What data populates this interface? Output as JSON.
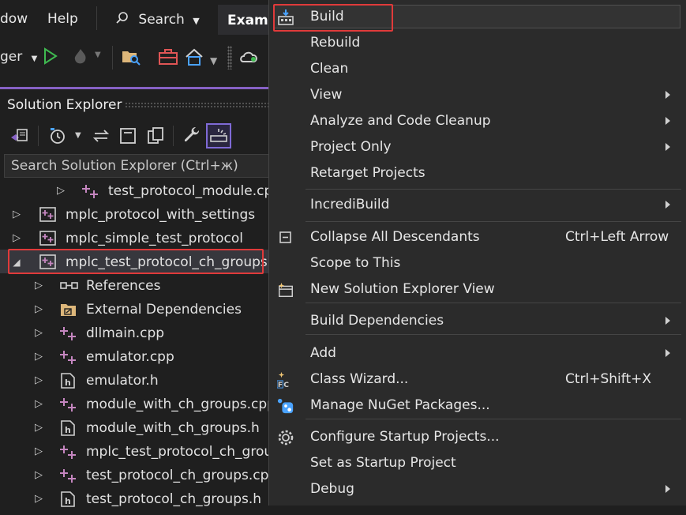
{
  "menubar": {
    "items": [
      "dow",
      "Help"
    ],
    "search_label": "Search",
    "document_tab": "Examp"
  },
  "toolbar": {
    "debugger_label": "ger"
  },
  "solution_explorer": {
    "title": "Solution Explorer",
    "search_placeholder": "Search Solution Explorer (Ctrl+ж)",
    "rows": [
      {
        "label": "test_protocol_module.cpp",
        "icon": "cpp-file-icon",
        "indent": 1,
        "expandable": true
      },
      {
        "label": "mplc_protocol_with_settings",
        "icon": "cpp-project-icon",
        "indent": 0,
        "expandable": true
      },
      {
        "label": "mplc_simple_test_protocol",
        "icon": "cpp-project-icon",
        "indent": 0,
        "expandable": true
      },
      {
        "label": "mplc_test_protocol_ch_groups",
        "icon": "cpp-project-icon",
        "indent": 0,
        "expandable": true,
        "expanded": true,
        "selected": true
      },
      {
        "label": "References",
        "icon": "references-icon",
        "indent": 1,
        "expandable": true
      },
      {
        "label": "External Dependencies",
        "icon": "folder-icon",
        "indent": 1,
        "expandable": true
      },
      {
        "label": "dllmain.cpp",
        "icon": "cpp-file-icon",
        "indent": 1,
        "expandable": true
      },
      {
        "label": "emulator.cpp",
        "icon": "cpp-file-icon",
        "indent": 1,
        "expandable": true
      },
      {
        "label": "emulator.h",
        "icon": "header-file-icon",
        "indent": 1,
        "expandable": true
      },
      {
        "label": "module_with_ch_groups.cpp",
        "icon": "cpp-file-icon",
        "indent": 1,
        "expandable": true
      },
      {
        "label": "module_with_ch_groups.h",
        "icon": "header-file-icon",
        "indent": 1,
        "expandable": true
      },
      {
        "label": "mplc_test_protocol_ch_group",
        "icon": "cpp-file-icon",
        "indent": 1,
        "expandable": true
      },
      {
        "label": "test_protocol_ch_groups.cpp",
        "icon": "cpp-file-icon",
        "indent": 1,
        "expandable": true
      },
      {
        "label": "test_protocol_ch_groups.h",
        "icon": "header-file-icon",
        "indent": 1,
        "expandable": true
      }
    ]
  },
  "context_menu": {
    "items": [
      {
        "label": "Build",
        "icon": "build-icon",
        "shortcut": "",
        "submenu": false,
        "highlighted": true
      },
      {
        "label": "Rebuild",
        "icon": "",
        "shortcut": "",
        "submenu": false
      },
      {
        "label": "Clean",
        "icon": "",
        "shortcut": "",
        "submenu": false
      },
      {
        "label": "View",
        "icon": "",
        "shortcut": "",
        "submenu": true
      },
      {
        "label": "Analyze and Code Cleanup",
        "icon": "",
        "shortcut": "",
        "submenu": true
      },
      {
        "label": "Project Only",
        "icon": "",
        "shortcut": "",
        "submenu": true
      },
      {
        "label": "Retarget Projects",
        "icon": "",
        "shortcut": "",
        "submenu": false
      },
      {
        "label": "IncrediBuild",
        "icon": "",
        "shortcut": "",
        "submenu": true
      },
      {
        "label": "Collapse All Descendants",
        "icon": "collapse-all-icon",
        "shortcut": "Ctrl+Left Arrow",
        "submenu": false
      },
      {
        "label": "Scope to This",
        "icon": "",
        "shortcut": "",
        "submenu": false
      },
      {
        "label": "New Solution Explorer View",
        "icon": "new-view-icon",
        "shortcut": "",
        "submenu": false
      },
      {
        "label": "Build Dependencies",
        "icon": "",
        "shortcut": "",
        "submenu": true
      },
      {
        "label": "Add",
        "icon": "",
        "shortcut": "",
        "submenu": true
      },
      {
        "label": "Class Wizard...",
        "icon": "class-wizard-icon",
        "shortcut": "Ctrl+Shift+X",
        "submenu": false
      },
      {
        "label": "Manage NuGet Packages...",
        "icon": "nuget-icon",
        "shortcut": "",
        "submenu": false
      },
      {
        "label": "Configure Startup Projects...",
        "icon": "gear-icon",
        "shortcut": "",
        "submenu": false
      },
      {
        "label": "Set as Startup Project",
        "icon": "",
        "shortcut": "",
        "submenu": false
      },
      {
        "label": "Debug",
        "icon": "",
        "shortcut": "",
        "submenu": true
      }
    ]
  },
  "colors": {
    "accent": "#8661c5",
    "highlight_border": "#e03a3a",
    "menu_background": "#2b2b2b",
    "panel_background": "#1f1f1f"
  }
}
